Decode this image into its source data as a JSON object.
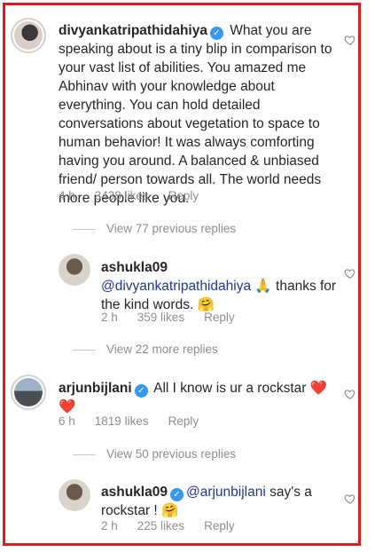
{
  "comments": [
    {
      "username": "divyankatripathidahiya",
      "text": " What you are speaking about is a tiny blip in comparison to your vast list of abilities. You amazed me Abhinav with your knowledge about everything. You can hold detailed conversations about vegetation to space to human behavior! It was always comforting having you around. A balanced & unbiased friend/ person towards all. The world needs more people like you.",
      "time": "4 h",
      "likes": "3438 likes",
      "reply": "Reply"
    },
    {
      "username": "ashukla09",
      "mention": "@divyankatripathidahiya",
      "text_after": " 🙏 thanks for the kind words. 🤗",
      "time": "2 h",
      "likes": "359 likes",
      "reply": "Reply"
    },
    {
      "username": "arjunbijlani",
      "text": " All I know is ur a rockstar ❤️ ❤️",
      "time": "6 h",
      "likes": "1819 likes",
      "reply": "Reply"
    },
    {
      "username": "ashukla09",
      "mention": "@arjunbijlani",
      "text_after": " say's a rockstar ! 🤗",
      "time": "2 h",
      "likes": "225 likes",
      "reply": "Reply"
    }
  ],
  "view_links": [
    "View 77 previous replies",
    "View 22 more replies",
    "View 50 previous replies"
  ],
  "colors": {
    "frame": "#e0191f",
    "verified": "#3897f0",
    "meta": "#8e8e8e"
  },
  "icons": {
    "like": "heart-outline-icon",
    "verified": "verified-badge-icon"
  }
}
